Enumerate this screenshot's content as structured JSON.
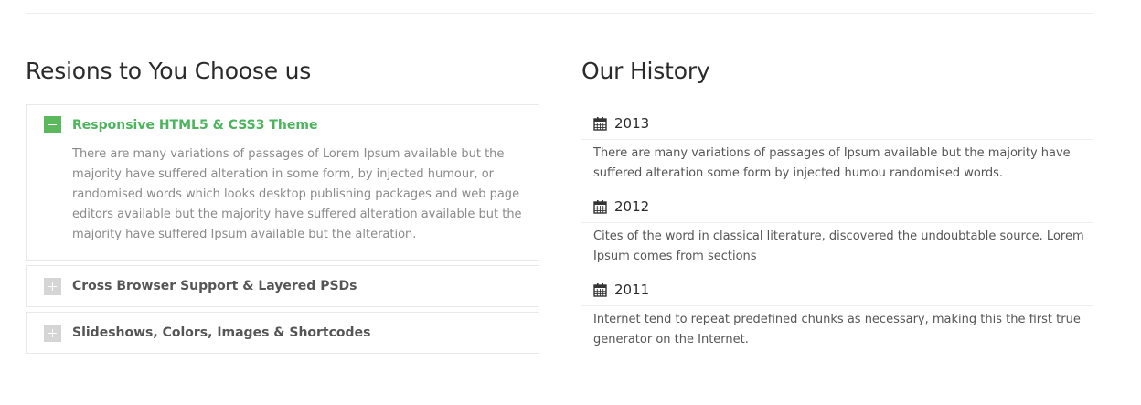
{
  "left": {
    "title": "Resions to You Choose us",
    "accordion": [
      {
        "title": "Responsive HTML5 & CSS3 Theme",
        "state": "open",
        "body": "There are many variations of passages of Lorem Ipsum available but the majority have suffered alteration in some form, by injected humour, or randomised words which looks desktop publishing packages and web page editors available but the majority have suffered alteration available but the majority have suffered Ipsum available but the alteration."
      },
      {
        "title": "Cross Browser Support & Layered PSDs",
        "state": "closed"
      },
      {
        "title": "Slideshows, Colors, Images & Shortcodes",
        "state": "closed"
      }
    ]
  },
  "right": {
    "title": "Our History",
    "entries": [
      {
        "year": "2013",
        "text": "There are many variations of passages of Ipsum available but the majority have suffered alteration some form by injected humou randomised words."
      },
      {
        "year": "2012",
        "text": "Cites of the word in classical literature, discovered the undoubtable source. Lorem Ipsum comes from sections"
      },
      {
        "year": "2011",
        "text": "Internet tend to repeat predefined chunks as necessary, making this the first true generator on the Internet."
      }
    ]
  },
  "colors": {
    "accent": "#5cb85c",
    "accent_text": "#4cb45c",
    "toggle_closed": "#d5d5d5"
  },
  "icons": {
    "year_icon": "calendar-icon",
    "open_toggle": "minus-icon",
    "closed_toggle": "plus-icon"
  }
}
